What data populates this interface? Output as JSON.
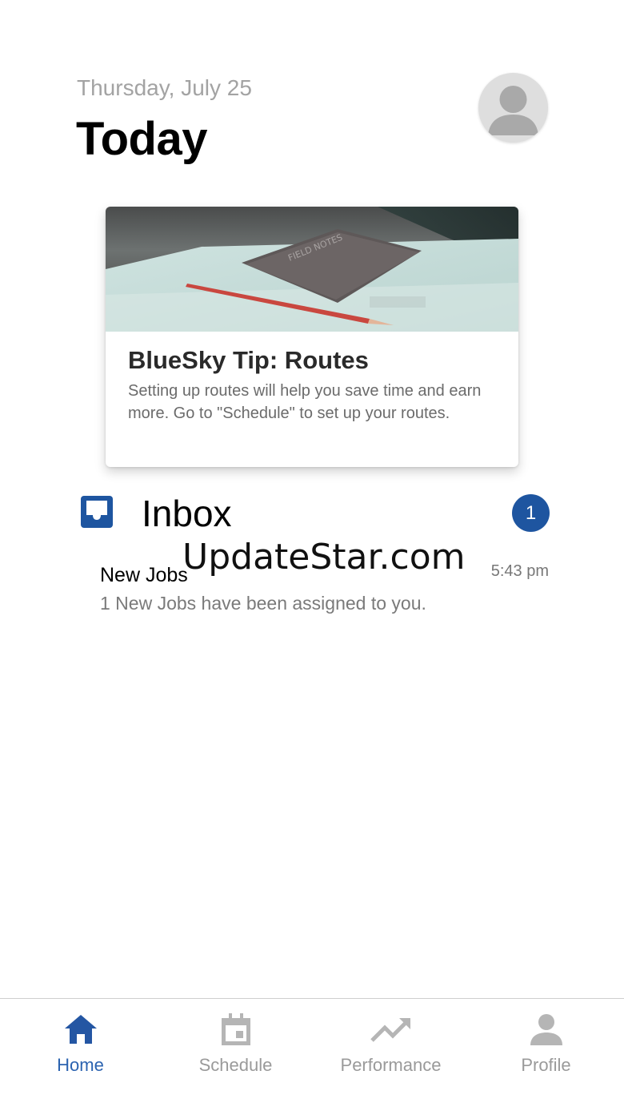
{
  "header": {
    "date": "Thursday, July 25",
    "title": "Today"
  },
  "tip_card": {
    "title": "BlueSky Tip: Routes",
    "body": "Setting up routes will help you save time and earn more. Go to \"Schedule\" to set up your routes."
  },
  "inbox": {
    "title": "Inbox",
    "badge_count": "1",
    "messages": [
      {
        "sender": "New Jobs",
        "time": "5:43 pm",
        "preview": "1 New Jobs have been assigned to you."
      }
    ]
  },
  "watermark": "UpdateStar.com",
  "tabbar": {
    "tabs": [
      {
        "label": "Home",
        "icon": "home-icon",
        "active": true
      },
      {
        "label": "Schedule",
        "icon": "calendar-icon",
        "active": false
      },
      {
        "label": "Performance",
        "icon": "trending-up-icon",
        "active": false
      },
      {
        "label": "Profile",
        "icon": "person-icon",
        "active": false
      }
    ]
  },
  "colors": {
    "accent": "#1e55a0",
    "active_tab": "#2b63b0",
    "inactive_tab": "#9a9a9a",
    "date_text": "#a3a3a3"
  }
}
